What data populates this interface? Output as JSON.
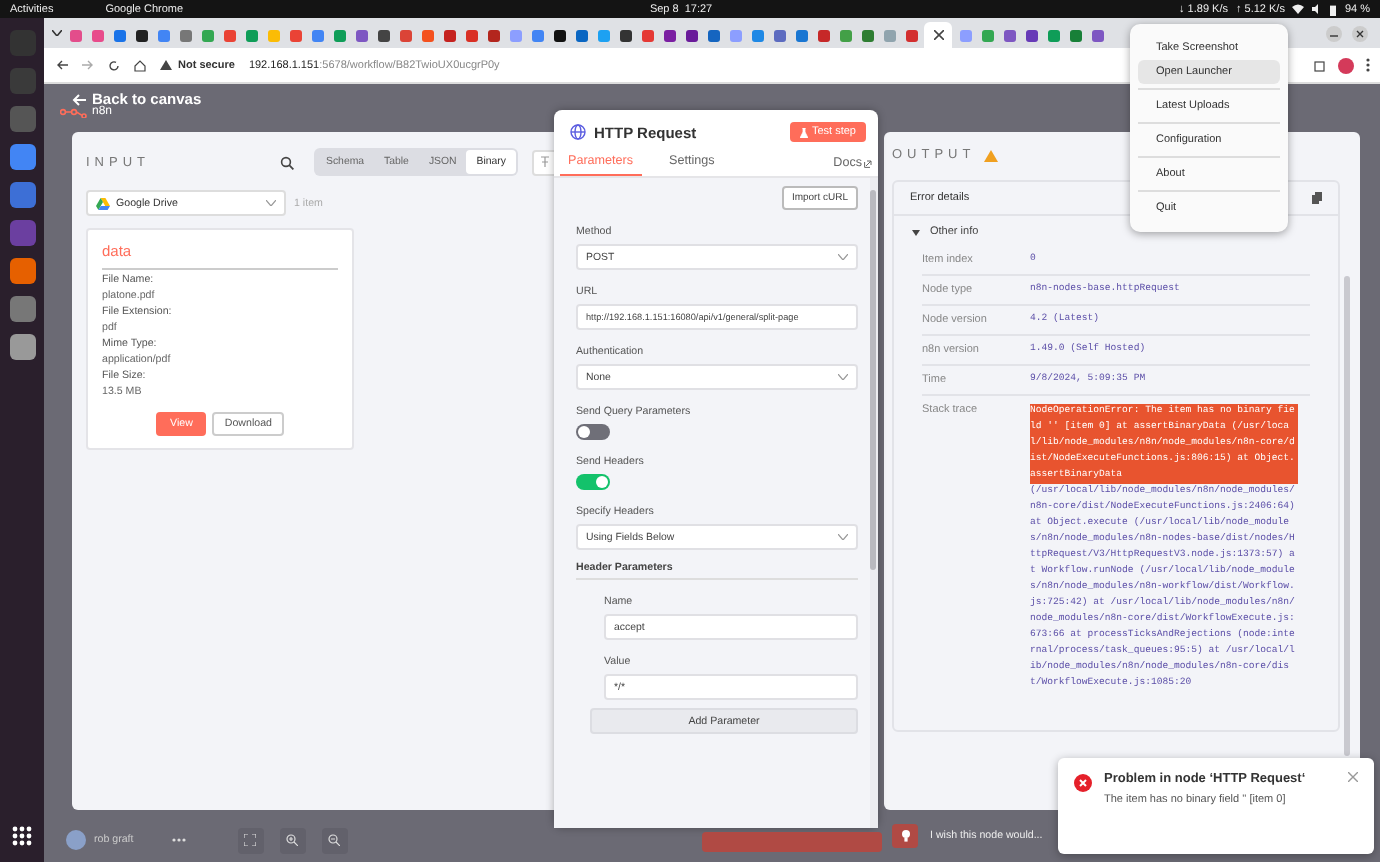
{
  "system_bar": {
    "activities": "Activities",
    "app": "Google Chrome",
    "date": "Sep 8",
    "time": "17:27",
    "net_down": "↓ 1.89 K/s",
    "net_up": "↑ 5.12 K/s",
    "battery": "94 %"
  },
  "browser": {
    "tabs": [
      {
        "color": "#e34d8b",
        "selected": false
      },
      {
        "color": "#e84b8b",
        "selected": false
      },
      {
        "color": "#1a73e8",
        "selected": false
      },
      {
        "color": "#222222",
        "selected": false
      },
      {
        "color": "#4285f4",
        "selected": false
      },
      {
        "color": "#777777",
        "selected": false
      },
      {
        "color": "#34a853",
        "selected": false
      },
      {
        "color": "#ea4335",
        "selected": false
      },
      {
        "color": "#0f9d58",
        "selected": false
      },
      {
        "color": "#fbbc05",
        "selected": false
      },
      {
        "color": "#ea4335",
        "selected": false
      },
      {
        "color": "#4285f4",
        "selected": false
      },
      {
        "color": "#0f9d58",
        "selected": false
      },
      {
        "color": "#7e57c2",
        "selected": false
      },
      {
        "color": "#444444",
        "selected": false
      },
      {
        "color": "#db4437",
        "selected": false
      },
      {
        "color": "#f4511e",
        "selected": false
      },
      {
        "color": "#c5221f",
        "selected": false
      },
      {
        "color": "#d93025",
        "selected": false
      },
      {
        "color": "#b3261e",
        "selected": false
      },
      {
        "color": "#8c9eff",
        "selected": false
      },
      {
        "color": "#4285f4",
        "selected": false
      },
      {
        "color": "#111111",
        "selected": false
      },
      {
        "color": "#0a66c2",
        "selected": false
      },
      {
        "color": "#1da1f2",
        "selected": false
      },
      {
        "color": "#333333",
        "selected": false
      },
      {
        "color": "#e53935",
        "selected": false
      },
      {
        "color": "#7b1fa2",
        "selected": false
      },
      {
        "color": "#6a1b9a",
        "selected": false
      },
      {
        "color": "#1565c0",
        "selected": false
      },
      {
        "color": "#8c9eff",
        "selected": false
      },
      {
        "color": "#1e88e5",
        "selected": false
      },
      {
        "color": "#5c6bc0",
        "selected": false
      },
      {
        "color": "#1976d2",
        "selected": false
      },
      {
        "color": "#c62828",
        "selected": false
      },
      {
        "color": "#43a047",
        "selected": false
      },
      {
        "color": "#2e7d32",
        "selected": false
      },
      {
        "color": "#90a4ae",
        "selected": false
      },
      {
        "color": "#d32f2f",
        "selected": false
      },
      {
        "selected": true
      },
      {
        "color": "#8c9eff",
        "selected": false
      },
      {
        "color": "#34a853",
        "selected": false
      },
      {
        "color": "#7e57c2",
        "selected": false
      },
      {
        "color": "#673ab7",
        "selected": false
      },
      {
        "color": "#0f9d58",
        "selected": false
      },
      {
        "color": "#188038",
        "selected": false
      },
      {
        "color": "#7e57c2",
        "selected": false
      }
    ],
    "security": "Not secure",
    "url_host": "192.168.1.151",
    "url_path": ":5678/workflow/B82TwioUX0ucgrP0y"
  },
  "menu": {
    "groups": [
      [
        {
          "label": "Take Screenshot",
          "selected": false
        },
        {
          "label": "Open Launcher",
          "selected": true
        }
      ],
      [
        {
          "label": "Latest Uploads",
          "selected": false
        }
      ],
      [
        {
          "label": "Configuration",
          "selected": false
        }
      ],
      [
        {
          "label": "About",
          "selected": false
        }
      ],
      [
        {
          "label": "Quit",
          "selected": false
        }
      ]
    ]
  },
  "canvas": {
    "back": "Back to canvas",
    "logo": "n8n"
  },
  "input": {
    "title": "INPUT",
    "views": [
      {
        "label": "Schema",
        "selected": false
      },
      {
        "label": "Table",
        "selected": false
      },
      {
        "label": "JSON",
        "selected": false
      },
      {
        "label": "Binary",
        "selected": true
      }
    ],
    "source": "Google Drive",
    "count": "1 item",
    "binary": {
      "key": "data",
      "fields": [
        {
          "label": "File Name:",
          "value": "platone.pdf"
        },
        {
          "label": "File Extension:",
          "value": "pdf"
        },
        {
          "label": "Mime Type:",
          "value": "application/pdf"
        },
        {
          "label": "File Size:",
          "value": "13.5 MB"
        }
      ],
      "view": "View",
      "download": "Download"
    }
  },
  "node": {
    "title": "HTTP Request",
    "test": "Test step",
    "tabs": [
      {
        "label": "Parameters",
        "selected": true
      },
      {
        "label": "Settings",
        "selected": false
      }
    ],
    "docs": "Docs",
    "import": "Import cURL",
    "fields": [
      {
        "kind": "select",
        "label": "Method",
        "value": "POST"
      },
      {
        "kind": "input",
        "label": "URL",
        "value": "http://192.168.1.151:16080/api/v1/general/split-page"
      },
      {
        "kind": "select",
        "label": "Authentication",
        "value": "None"
      },
      {
        "kind": "toggle",
        "label": "Send Query Parameters",
        "on": false
      },
      {
        "kind": "toggle",
        "label": "Send Headers",
        "on": true
      },
      {
        "kind": "select",
        "label": "Specify Headers",
        "value": "Using Fields Below"
      }
    ],
    "header_params": {
      "title": "Header Parameters",
      "fields": [
        {
          "label": "Name",
          "value": "accept"
        },
        {
          "label": "Value",
          "value": "*/*"
        }
      ],
      "add": "Add Parameter"
    }
  },
  "output": {
    "title": "OUTPUT",
    "error_title": "Error details",
    "section": "Other info",
    "rows": [
      {
        "label": "Item index",
        "value": "0"
      },
      {
        "label": "Node type",
        "value": "n8n-nodes-base.httpRequest"
      },
      {
        "label": "Node version",
        "value": "4.2 (Latest)"
      },
      {
        "label": "n8n version",
        "value": "1.49.0 (Self Hosted)"
      },
      {
        "label": "Time",
        "value": "9/8/2024, 5:09:35 PM"
      }
    ],
    "stack_label": "Stack trace",
    "stack_selected": "NodeOperationError: The item has no binary field '' [item 0] at assertBinaryData (/usr/local/lib/node_modules/n8n/node_modules/n8n-core/dist/NodeExecuteFunctions.js:806:15) at Object.assertBinaryData",
    "stack_rest": "(/usr/local/lib/node_modules/n8n/node_modules/n8n-core/dist/NodeExecuteFunctions.js:2406:64) at Object.execute (/usr/local/lib/node_modules/n8n/node_modules/n8n-nodes-base/dist/nodes/HttpRequest/V3/HttpRequestV3.node.js:1373:57) at Workflow.runNode (/usr/local/lib/node_modules/n8n/node_modules/n8n-workflow/dist/Workflow.js:725:42) at /usr/local/lib/node_modules/n8n/node_modules/n8n-core/dist/WorkflowExecute.js:673:66 at processTicksAndRejections (node:internal/process/task_queues:95:5) at /usr/local/lib/node_modules/n8n/node_modules/n8n-core/dist/WorkflowExecute.js:1085:20"
  },
  "bottom_bar": {
    "user": "rob graft",
    "feedback": "I wish this node would..."
  },
  "toast": {
    "title": "Problem in node ‘HTTP Request‘",
    "message": "The item has no binary field '' [item 0]"
  }
}
